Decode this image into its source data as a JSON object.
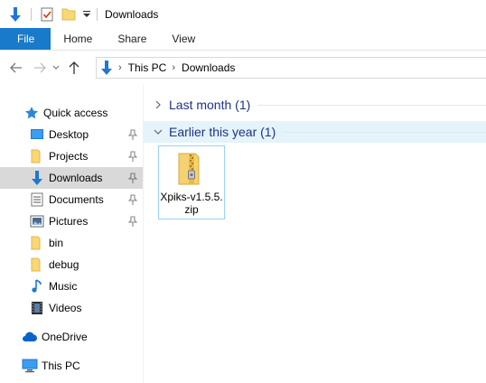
{
  "window": {
    "title": "Downloads"
  },
  "ribbon": {
    "tabs": [
      {
        "label": "File"
      },
      {
        "label": "Home"
      },
      {
        "label": "Share"
      },
      {
        "label": "View"
      }
    ]
  },
  "address": {
    "crumbs": [
      "This PC",
      "Downloads"
    ]
  },
  "sidebar": {
    "quick_access": "Quick access",
    "items": [
      {
        "label": "Desktop",
        "pinned": true
      },
      {
        "label": "Projects",
        "pinned": true
      },
      {
        "label": "Downloads",
        "pinned": true,
        "selected": true
      },
      {
        "label": "Documents",
        "pinned": true
      },
      {
        "label": "Pictures",
        "pinned": true
      },
      {
        "label": "bin",
        "pinned": false
      },
      {
        "label": "debug",
        "pinned": false
      },
      {
        "label": "Music",
        "pinned": false
      },
      {
        "label": "Videos",
        "pinned": false
      }
    ],
    "onedrive": "OneDrive",
    "this_pc": "This PC"
  },
  "content": {
    "groups": [
      {
        "label": "Last month (1)",
        "expanded": false
      },
      {
        "label": "Earlier this year (1)",
        "expanded": true
      }
    ],
    "files": [
      {
        "name": "Xpiks-v1.5.5.zip",
        "icon": "zip-folder-icon"
      }
    ]
  },
  "colors": {
    "accent": "#1979ca",
    "selected_nav": "#d9d9d9",
    "group_text": "#1e3287",
    "group_active_bg": "#e5f3fb",
    "tile_border": "#99d1ff"
  }
}
